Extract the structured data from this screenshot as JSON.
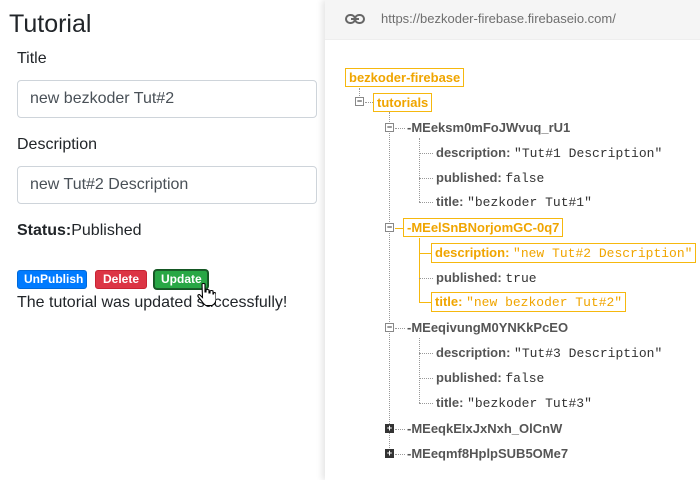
{
  "form": {
    "heading": "Tutorial",
    "title_label": "Title",
    "title_value": "new bezkoder Tut#2",
    "description_label": "Description",
    "description_value": "new Tut#2 Description",
    "status_label": "Status:",
    "status_value": "Published",
    "buttons": {
      "unpublish": "UnPublish",
      "delete": "Delete",
      "update": "Update"
    },
    "message": "The tutorial was updated successfully!"
  },
  "firebase": {
    "url": "https://bezkoder-firebase.firebaseio.com/",
    "root": "bezkoder-firebase",
    "collection": "tutorials",
    "items": [
      {
        "id": "-MEeksm0mFoJWvuq_rU1",
        "description_key": "description:",
        "description_value": "\"Tut#1 Description\"",
        "published_key": "published:",
        "published_value": "false",
        "title_key": "title:",
        "title_value": "\"bezkoder Tut#1\""
      },
      {
        "id": "-MEelSnBNorjomGC-0q7",
        "description_key": "description:",
        "description_value": "\"new Tut#2 Description\"",
        "published_key": "published:",
        "published_value": "true",
        "title_key": "title:",
        "title_value": "\"new bezkoder Tut#2\""
      },
      {
        "id": "-MEeqivungM0YNKkPcEO",
        "description_key": "description:",
        "description_value": "\"Tut#3 Description\"",
        "published_key": "published:",
        "published_value": "false",
        "title_key": "title:",
        "title_value": "\"bezkoder Tut#3\""
      },
      {
        "id": "-MEeqkEIxJxNxh_OlCnW"
      },
      {
        "id": "-MEeqmf8HplpSUB5OMe7"
      }
    ],
    "colors": {
      "highlight": "#f6b80e"
    }
  }
}
